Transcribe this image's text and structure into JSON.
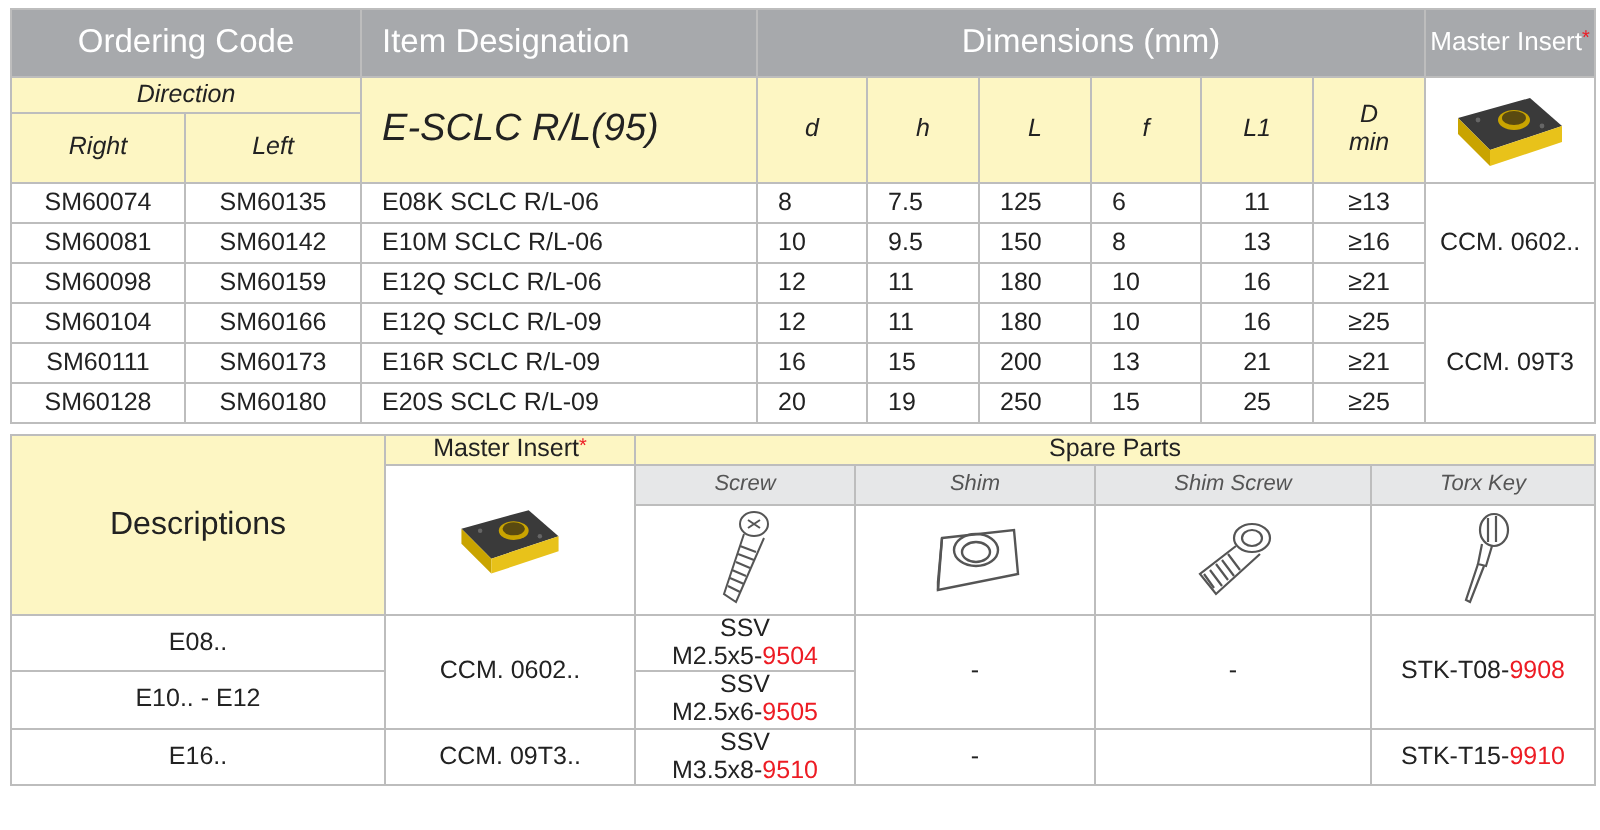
{
  "spec_table": {
    "headers": {
      "ordering_code": "Ordering Code",
      "item_designation": "Item Designation",
      "dimensions": "Dimensions (mm)",
      "master_insert": {
        "label": "Master Insert",
        "mark": "*"
      }
    },
    "direction": "Direction",
    "right": "Right",
    "left": "Left",
    "series": "E-SCLC R/L(95)",
    "dimension_columns": [
      {
        "label": "d"
      },
      {
        "label": "h"
      },
      {
        "label": "L"
      },
      {
        "label": "f"
      },
      {
        "label": "L1"
      },
      {
        "label": "D",
        "sub": "min"
      }
    ],
    "groups": [
      {
        "master_insert": "CCM. 0602..",
        "rows": [
          {
            "right": "SM60074",
            "left": "SM60135",
            "item": "E08K SCLC R/L-06",
            "dims": [
              "8",
              "7.5",
              "125",
              "6",
              "11",
              "≥13"
            ]
          },
          {
            "right": "SM60081",
            "left": "SM60142",
            "item": "E10M SCLC R/L-06",
            "dims": [
              "10",
              "9.5",
              "150",
              "8",
              "13",
              "≥16"
            ]
          },
          {
            "right": "SM60098",
            "left": "SM60159",
            "item": "E12Q SCLC R/L-06",
            "dims": [
              "12",
              "11",
              "180",
              "10",
              "16",
              "≥21"
            ]
          }
        ]
      },
      {
        "master_insert": "CCM. 09T3",
        "rows": [
          {
            "right": "SM60104",
            "left": "SM60166",
            "item": "E12Q SCLC R/L-09",
            "dims": [
              "12",
              "11",
              "180",
              "10",
              "16",
              "≥25"
            ]
          },
          {
            "right": "SM60111",
            "left": "SM60173",
            "item": "E16R SCLC R/L-09",
            "dims": [
              "16",
              "15",
              "200",
              "13",
              "21",
              "≥21"
            ]
          },
          {
            "right": "SM60128",
            "left": "SM60180",
            "item": "E20S SCLC R/L-09",
            "dims": [
              "20",
              "19",
              "250",
              "15",
              "25",
              "≥25"
            ]
          }
        ]
      }
    ]
  },
  "parts_table": {
    "headers": {
      "descriptions": "Descriptions",
      "master_insert": {
        "label": "Master Insert",
        "mark": "*"
      },
      "spare_parts": "Spare Parts"
    },
    "part_columns": [
      {
        "label": "Screw",
        "kind": "screw"
      },
      {
        "label": "Shim",
        "kind": "shim"
      },
      {
        "label": "Shim Screw",
        "kind": "shim_screw"
      },
      {
        "label": "Torx Key",
        "kind": "key"
      }
    ],
    "groups": [
      {
        "master_insert": "CCM. 0602..",
        "shim": "-",
        "shim_screw": "-",
        "torx_key": {
          "code": "STK-T08-",
          "suffix": "9908"
        },
        "rows": [
          {
            "description": "E08..",
            "screw": {
              "type": "SSV",
              "code": "M2.5x5-",
              "suffix": "9504"
            }
          },
          {
            "description": "E10.. - E12",
            "screw": {
              "type": "SSV",
              "code": "M2.5x6-",
              "suffix": "9505"
            }
          }
        ]
      },
      {
        "master_insert": "CCM. 09T3..",
        "shim": "-",
        "torx_key": {
          "code": "STK-T15-",
          "suffix": "9910"
        },
        "rows": [
          {
            "description": "E16..",
            "screw": {
              "type": "SSV",
              "code": "M3.5x8-",
              "suffix": "9510"
            }
          }
        ]
      }
    ]
  }
}
